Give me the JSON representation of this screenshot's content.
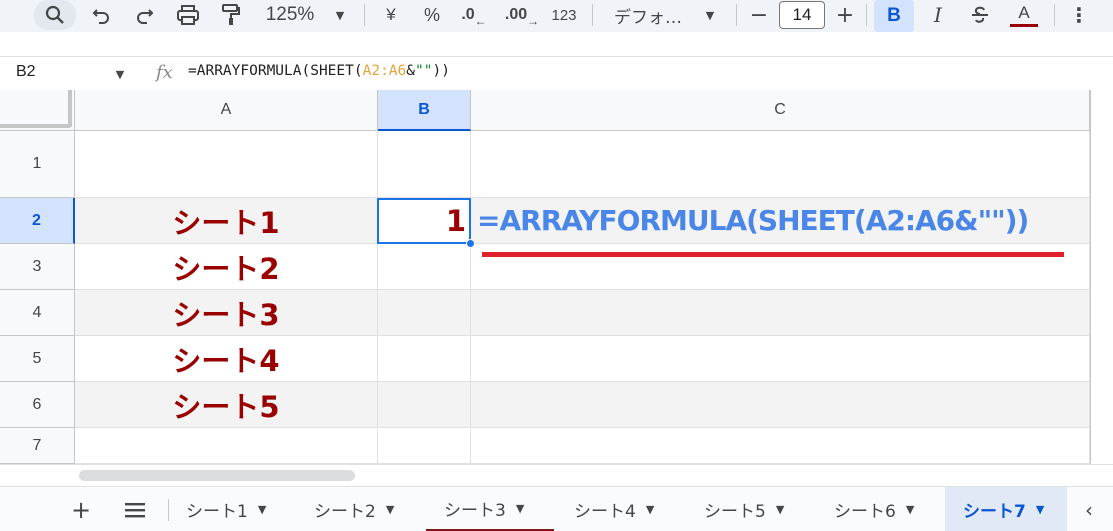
{
  "toolbar": {
    "zoom": "125%",
    "currency": "¥",
    "percent": "%",
    "dec_decrease": ".0",
    "dec_increase": ".00",
    "format_123": "123",
    "font_name": "デフォ…",
    "font_size": "14",
    "minus": "−",
    "plus": "+",
    "bold": "B",
    "italic": "I",
    "text_color": "A",
    "more": "⋮"
  },
  "formula_bar": {
    "name_box": "B2",
    "fx": "fx",
    "formula_prefix": "=ARRAYFORMULA(SHEET(",
    "formula_ref": "A2:A6",
    "formula_amp": "&",
    "formula_str": "\"\"",
    "formula_suffix": "))"
  },
  "columns": [
    "A",
    "B",
    "C"
  ],
  "rows": [
    "1",
    "2",
    "3",
    "4",
    "5",
    "6",
    "7"
  ],
  "cells": {
    "A2": "シート1",
    "A3": "シート2",
    "A4": "シート3",
    "A5": "シート4",
    "A6": "シート5",
    "B2": "1",
    "C2": "=ARRAYFORMULA(SHEET(A2:A6&\"\"))"
  },
  "tabs": [
    {
      "label": "シート1"
    },
    {
      "label": "シート2"
    },
    {
      "label": "シート3"
    },
    {
      "label": "シート4"
    },
    {
      "label": "シート5"
    },
    {
      "label": "シート6"
    },
    {
      "label": "シート7"
    }
  ],
  "colors": {
    "sheet_text": "#990000",
    "formula_text": "#4a86e8",
    "selection": "#1a73e8",
    "annotation_line": "#e0202a"
  }
}
